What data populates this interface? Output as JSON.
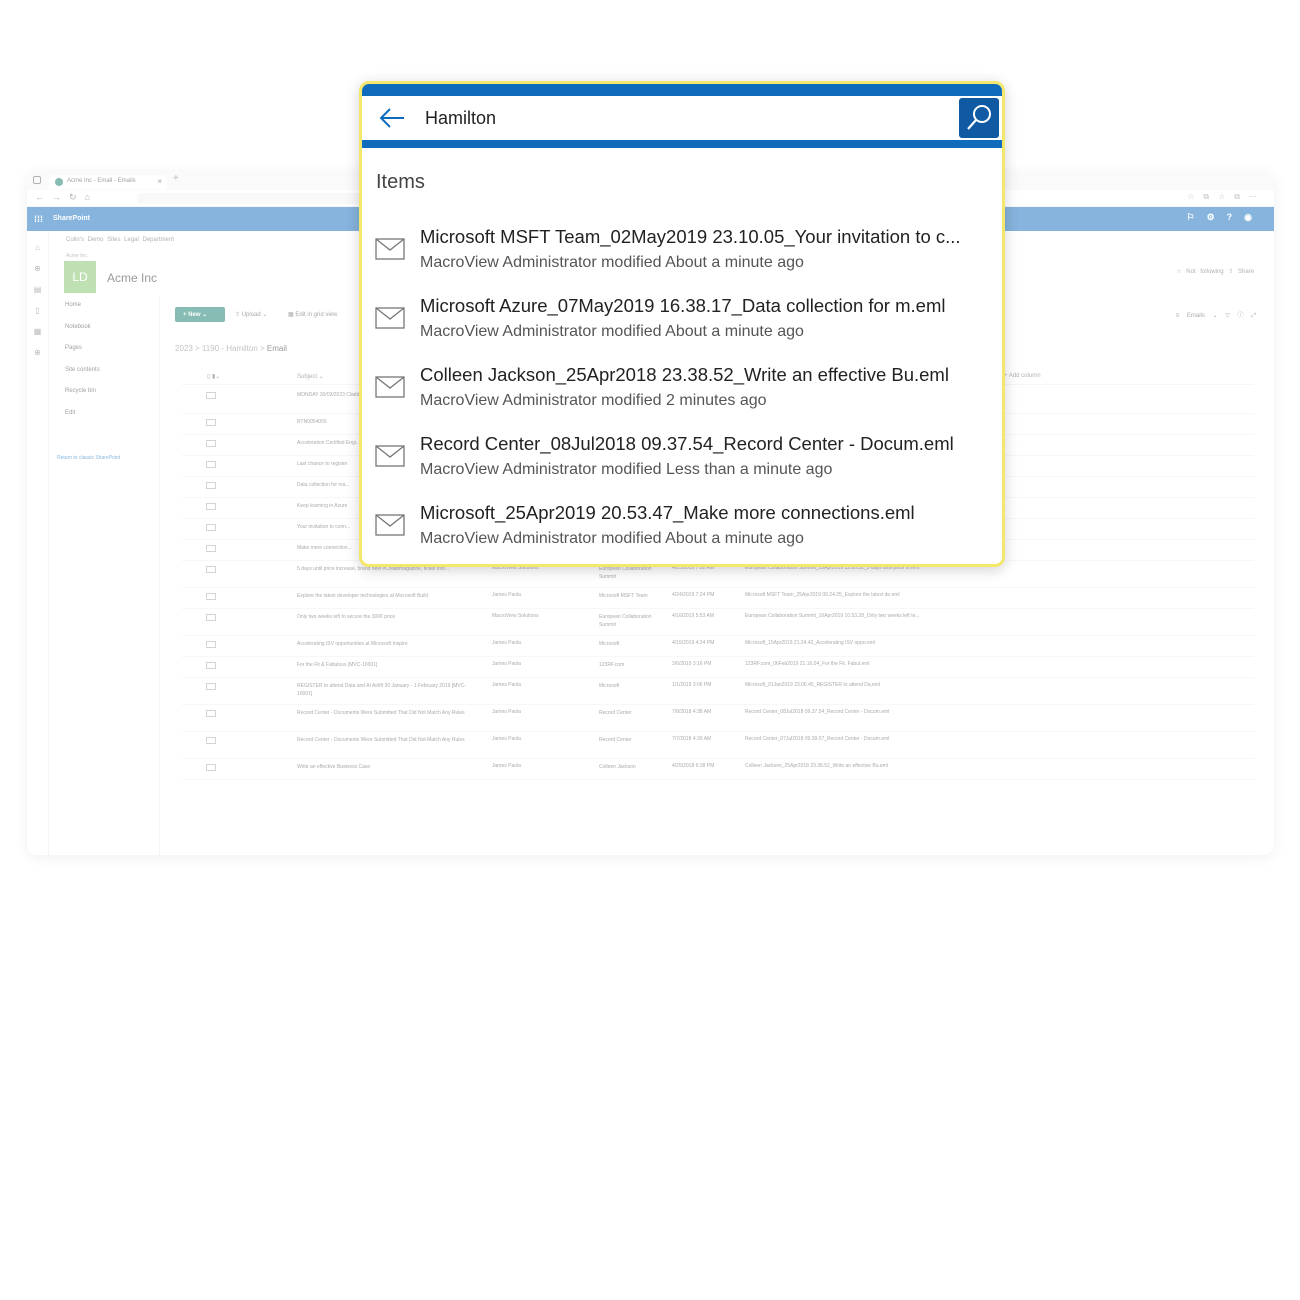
{
  "browser": {
    "tab_title": "Acme Inc - Email - Emails",
    "tab_close": "×",
    "new_tab": "+"
  },
  "sharepoint": {
    "brand": "SharePoint",
    "site_breadcrumb": "Colin's Demo Sites    Legal Department",
    "site_small": "Acme Inc",
    "site_initials": "LD",
    "site_title": "Acme Inc",
    "follow_share": "☆ Not following   ⇧ Share"
  },
  "sidenav": {
    "items": [
      "Home",
      "Notebook",
      "Pages",
      "Site contents",
      "Recycle bin",
      "Edit"
    ],
    "classic_link": "Return to classic SharePoint"
  },
  "commandbar": {
    "new_label": "+ New ⌄",
    "upload_label": "⇧ Upload ⌄",
    "grid_label": "▦ Edit in grid view",
    "right_label": "≡ Emails ⌄   ▽   ⓘ   ⤢"
  },
  "library_breadcrumb": {
    "path": "2023  >  1190 - Hamilton  >  ",
    "current": "Email"
  },
  "list_header": {
    "subject": "Subject ⌄",
    "add_column": "+ Add column"
  },
  "background_rows": [
    {
      "subject": "MONDAY 30/03/2023 Cladding",
      "from": "",
      "to": "",
      "date": "",
      "file": ""
    },
    {
      "subject": "RTN0054055",
      "from": "",
      "to": "",
      "date": "",
      "file": ""
    },
    {
      "subject": "Acceleration Certified Engi...",
      "from": "",
      "to": "",
      "date": "",
      "file": ""
    },
    {
      "subject": "Last chance to register",
      "from": "",
      "to": "",
      "date": "",
      "file": ""
    },
    {
      "subject": "Data collection for ma...",
      "from": "",
      "to": "",
      "date": "",
      "file": ""
    },
    {
      "subject": "Keep learning in Azure",
      "from": "",
      "to": "",
      "date": "",
      "file": ""
    },
    {
      "subject": "Your invitation to conn...",
      "from": "",
      "to": "",
      "date": "",
      "file": ""
    },
    {
      "subject": "Make more connection...",
      "from": "",
      "to": "",
      "date": "",
      "file": ""
    },
    {
      "subject": "5 days until price increase, brand new #Collabmagazine, ticket info...",
      "from": "MacroView Solutions",
      "to": "European Collaboration Summit",
      "date": "4/25/2019 7:02 AM",
      "file": "European Collaboration Summit_25Apr2019 12.00.32_5 days until price in.eml"
    },
    {
      "subject": "Explore the latest developer technologies at Microsoft Build",
      "from": "James Paola",
      "to": "Microsoft MSFT Team",
      "date": "4/24/2019 7:24 PM",
      "file": "Microsoft MSFT Team_25Apr2019 00.24.25_Explore the latest de.eml"
    },
    {
      "subject": "Only two weeks left to secure the 300€ price",
      "from": "MacroView Solutions",
      "to": "European Collaboration Summit",
      "date": "4/16/2019 5:53 AM",
      "file": "European Collaboration Summit_16Apr2019 10.53.28_Only two weeks left te..."
    },
    {
      "subject": "Accelerating ISV opportunities at Microsoft Inspire",
      "from": "James Paola",
      "to": "Microsoft",
      "date": "4/15/2019 4:24 PM",
      "file": "Microsoft_15Apr2019 21.24.42_Accelerating ISV oppo.eml"
    },
    {
      "subject": "For the Fit & Fabulous [MVC-10001]",
      "from": "James Paola",
      "to": "123RF.com",
      "date": "2/6/2019 3:16 PM",
      "file": "123RF.com_06Feb2019 21.16.04_For the Fit. Fabul.eml"
    },
    {
      "subject": "REGISTER to attend Data and AI Airlift 30 January - 1 February 2019 [MVC-10001]",
      "from": "James Paola",
      "to": "Microsoft",
      "date": "1/1/2019 3:06 PM",
      "file": "Microsoft_01Jan2019 23.06.45_REGISTER to attend Da.eml"
    },
    {
      "subject": "Record Center - Documents Were Submitted That Did Not Match Any Rules",
      "from": "James Paola",
      "to": "Record Center",
      "date": "7/8/2018 4:38 AM",
      "file": "Record Center_08Jul2018 09.37.54_Record Center - Docum.eml"
    },
    {
      "subject": "Record Center - Documents Were Submitted That Did Not Match Any Rules",
      "from": "James Paola",
      "to": "Record Center",
      "date": "7/7/2018 4:39 AM",
      "file": "Record Center_07Jul2018 09.39.07_Record Center - Docum.eml"
    },
    {
      "subject": "Write an effective Business Case",
      "from": "James Paola",
      "to": "Colleen Jackson",
      "date": "4/25/2018 6:38 PM",
      "file": "Colleen Jackson_25Apr2018 23.38.52_Write an effective Bu.eml"
    }
  ],
  "search": {
    "query": "Hamilton",
    "section_title": "Items",
    "results": [
      {
        "title": "Microsoft MSFT Team_02May2019 23.10.05_Your invitation to c...",
        "subtitle": "MacroView Administrator modified About a minute ago"
      },
      {
        "title": "Microsoft Azure_07May2019 16.38.17_Data collection for m.eml",
        "subtitle": "MacroView Administrator modified About a minute ago"
      },
      {
        "title": "Colleen Jackson_25Apr2018 23.38.52_Write an effective Bu.eml",
        "subtitle": "MacroView Administrator modified 2 minutes ago"
      },
      {
        "title": "Record Center_08Jul2018 09.37.54_Record Center - Docum.eml",
        "subtitle": "MacroView Administrator modified Less than a minute ago"
      },
      {
        "title": "Microsoft_25Apr2019 20.53.47_Make more connections.eml",
        "subtitle": "MacroView Administrator modified About a minute ago"
      }
    ]
  },
  "colors": {
    "accent_blue": "#0f6cbd",
    "search_button": "#0f5aa3",
    "highlight_border": "#f3e86b",
    "site_logo": "#7fc26a",
    "new_button": "#0f7b6c"
  }
}
